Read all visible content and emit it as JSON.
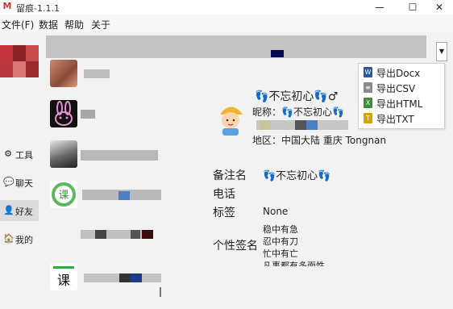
{
  "window": {
    "title": "留痕-1.1.1",
    "app_icon": "M",
    "minimize": "—",
    "maximize": "☐",
    "close": "✕"
  },
  "menu": {
    "items": [
      "文件(F)",
      "数据",
      "帮助",
      "关于"
    ]
  },
  "sidebar": {
    "items": [
      {
        "label": "工具",
        "icon": "tools-icon"
      },
      {
        "label": "聊天",
        "icon": "chat-icon"
      },
      {
        "label": "好友",
        "icon": "friends-icon"
      },
      {
        "label": "我的",
        "icon": "mine-icon"
      }
    ]
  },
  "export_menu": {
    "items": [
      {
        "label": "导出Docx",
        "color": "#2b5797",
        "glyph": "W"
      },
      {
        "label": "导出CSV",
        "color": "#7a7a7a",
        "glyph": "≡"
      },
      {
        "label": "导出HTML",
        "color": "#3a8d3a",
        "glyph": "X"
      },
      {
        "label": "导出TXT",
        "color": "#d9a400",
        "glyph": "T"
      }
    ]
  },
  "profile": {
    "nickname": "👣不忘初心👣♂",
    "nickname_label": "昵称：",
    "nickname_value": "👣不忘初心👣",
    "region_label": "地区：",
    "region_value": "中国大陆 重庆 Tongnan",
    "remark_label": "备注名",
    "remark_value": "👣不忘初心👣",
    "phone_label": "电话",
    "tag_label": "标签",
    "tag_value": "None",
    "signature_label": "个性签名",
    "signature_lines": [
      "稳中有急",
      "忍中有刀",
      "忙中有亡",
      "凡事都有多面性"
    ]
  },
  "colors": {
    "toolbar": "#c3c3c3",
    "accent_dark": "#000a5c",
    "active_sidebar": "#dcdcdc"
  }
}
